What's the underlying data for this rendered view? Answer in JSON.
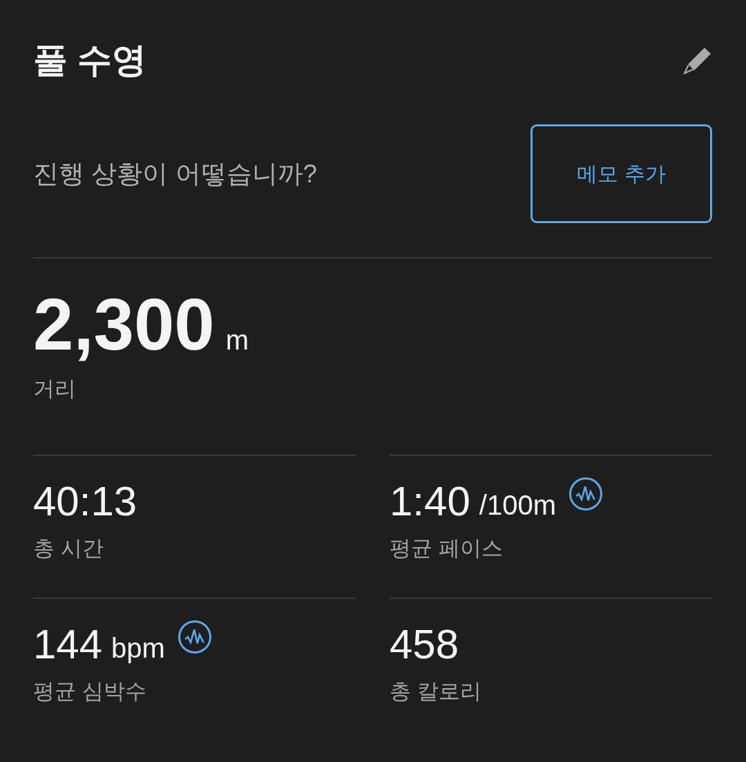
{
  "header": {
    "title": "풀 수영"
  },
  "note_prompt": {
    "question": "진행 상황이 어떻습니까?",
    "button": "메모 추가"
  },
  "distance": {
    "value": "2,300",
    "unit": "m",
    "label": "거리"
  },
  "stats": [
    {
      "kind": "plain",
      "value": "40:13",
      "label": "총 시간"
    },
    {
      "kind": "graph",
      "value": "1:40",
      "unit": "/100m",
      "label": "평균 페이스"
    },
    {
      "kind": "graph",
      "value": "144",
      "unit": "bpm",
      "label": "평균 심박수"
    },
    {
      "kind": "plain",
      "value": "458",
      "label": "총 칼로리"
    }
  ]
}
